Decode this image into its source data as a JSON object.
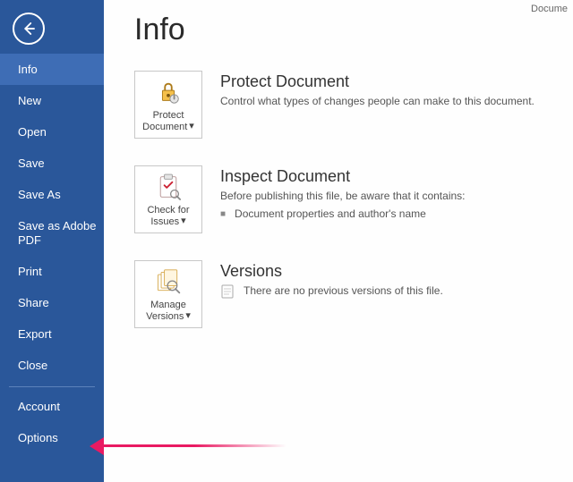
{
  "titleWord": "Docume",
  "sidebar": {
    "items": [
      {
        "label": "Info",
        "selected": true
      },
      {
        "label": "New",
        "selected": false
      },
      {
        "label": "Open",
        "selected": false
      },
      {
        "label": "Save",
        "selected": false
      },
      {
        "label": "Save As",
        "selected": false
      },
      {
        "label": "Save as Adobe PDF",
        "selected": false
      },
      {
        "label": "Print",
        "selected": false
      },
      {
        "label": "Share",
        "selected": false
      },
      {
        "label": "Export",
        "selected": false
      },
      {
        "label": "Close",
        "selected": false
      }
    ],
    "bottom": [
      {
        "label": "Account"
      },
      {
        "label": "Options"
      }
    ]
  },
  "page": {
    "title": "Info",
    "sections": {
      "protect": {
        "tileLabel1": "Protect",
        "tileLabel2": "Document",
        "heading": "Protect Document",
        "text": "Control what types of changes people can make to this document."
      },
      "inspect": {
        "tileLabel1": "Check for",
        "tileLabel2": "Issues",
        "heading": "Inspect Document",
        "text": "Before publishing this file, be aware that it contains:",
        "bullet1": "Document properties and author's name"
      },
      "versions": {
        "tileLabel1": "Manage",
        "tileLabel2": "Versions",
        "heading": "Versions",
        "text": "There are no previous versions of this file."
      }
    }
  },
  "icons": {
    "caret": "▾"
  }
}
